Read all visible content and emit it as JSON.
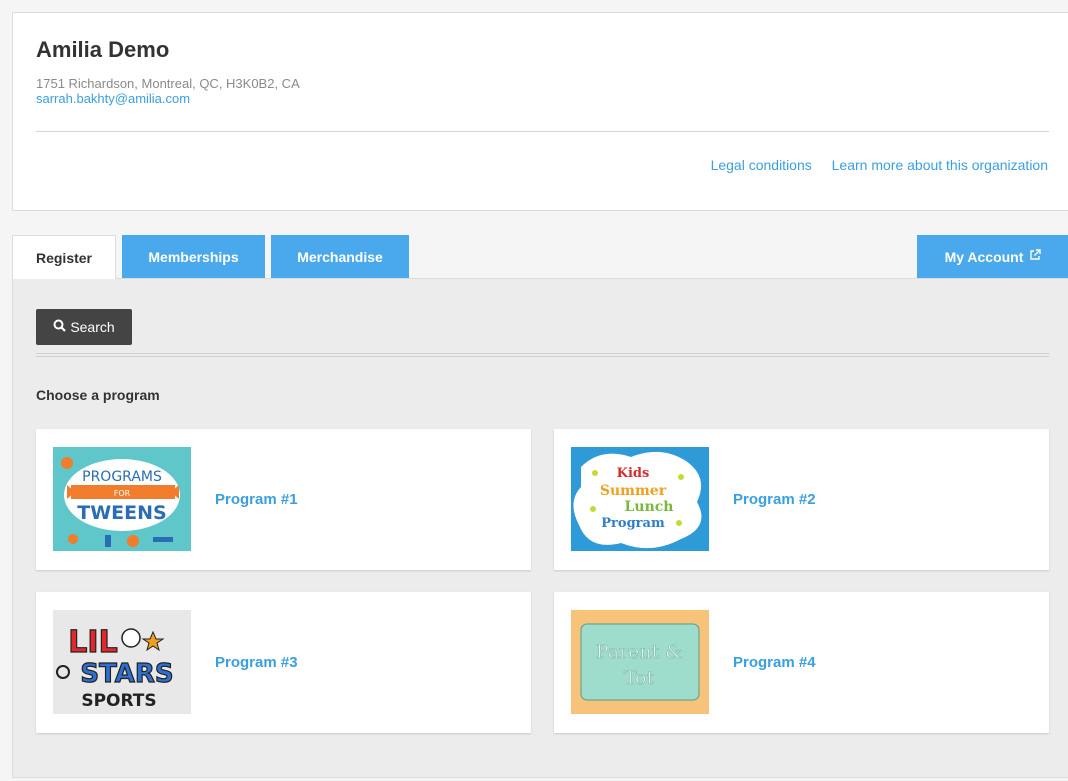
{
  "org": {
    "name": "Amilia Demo",
    "address": "1751 Richardson, Montreal, QC, H3K0B2, CA",
    "email": "sarrah.bakhty@amilia.com",
    "links": [
      "Legal conditions",
      "Learn more about this organization"
    ]
  },
  "tabs": {
    "register": "Register",
    "memberships": "Memberships",
    "merchandise": "Merchandise",
    "my_account": "My Account"
  },
  "search": {
    "label": "Search"
  },
  "section_title": "Choose a program",
  "programs": [
    {
      "title": "Program #1",
      "thumb_text": [
        "PROGRAMS",
        "FOR",
        "TWEENS"
      ]
    },
    {
      "title": "Program #2",
      "thumb_text": [
        "Kids",
        "Summer",
        "Lunch",
        "Program"
      ]
    },
    {
      "title": "Program #3",
      "thumb_text": [
        "LIL",
        "STARS",
        "SPORTS"
      ]
    },
    {
      "title": "Program #4",
      "thumb_text": [
        "Parent &",
        "Tot"
      ]
    }
  ],
  "colors": {
    "accent": "#4aa8ec",
    "link": "#3a9fe0",
    "search_bg": "#444444"
  },
  "icons": {
    "search": "search-icon",
    "external": "external-link-icon"
  }
}
